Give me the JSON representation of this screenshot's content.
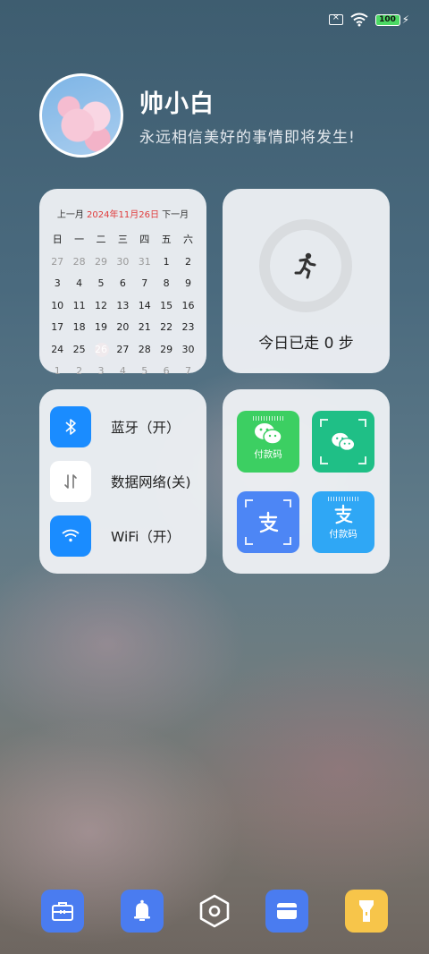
{
  "status_bar": {
    "battery": "100",
    "sim_icon": "no-sim-icon",
    "wifi_icon": "wifi-icon",
    "charging_icon": "bolt-icon"
  },
  "profile": {
    "name": "帅小白",
    "motto": "永远相信美好的事情即将发生!"
  },
  "calendar": {
    "prev": "上一月",
    "current": "2024年11月26日",
    "next": "下一月",
    "weekdays": [
      "日",
      "一",
      "二",
      "三",
      "四",
      "五",
      "六"
    ],
    "days": [
      [
        "27",
        "28",
        "29",
        "30",
        "31",
        "1",
        "2"
      ],
      [
        "3",
        "4",
        "5",
        "6",
        "7",
        "8",
        "9"
      ],
      [
        "10",
        "11",
        "12",
        "13",
        "14",
        "15",
        "16"
      ],
      [
        "17",
        "18",
        "19",
        "20",
        "21",
        "22",
        "23"
      ],
      [
        "24",
        "25",
        "26",
        "27",
        "28",
        "29",
        "30"
      ],
      [
        "1",
        "2",
        "3",
        "4",
        "5",
        "6",
        "7"
      ]
    ],
    "today": "26"
  },
  "steps": {
    "text": "今日已走 0 步",
    "icon": "running-icon"
  },
  "toggles": [
    {
      "label": "蓝牙（开）",
      "icon": "bluetooth-icon"
    },
    {
      "label": "数据网络(关)",
      "icon": "mobile-data-icon"
    },
    {
      "label": "WiFi（开）",
      "icon": "wifi-icon"
    }
  ],
  "payments": [
    {
      "label": "付款码",
      "icon": "wechat-icon",
      "color": "#3ccf62"
    },
    {
      "label": "",
      "icon": "wechat-scan-icon",
      "color": "#1fbf86"
    },
    {
      "label": "",
      "icon": "alipay-scan-icon",
      "color": "#4d86f5"
    },
    {
      "label": "付款码",
      "icon": "alipay-icon",
      "color": "#2fa7f5"
    }
  ],
  "dock": [
    {
      "icon": "toolbox-icon",
      "color": "#4a7cf0"
    },
    {
      "icon": "bell-icon",
      "color": "#4a7cf0"
    },
    {
      "icon": "hexagon-settings-icon",
      "color": "#ffffff"
    },
    {
      "icon": "wallet-card-icon",
      "color": "#4a7cf0"
    },
    {
      "icon": "flashlight-icon",
      "color": "#f7c54a"
    }
  ]
}
